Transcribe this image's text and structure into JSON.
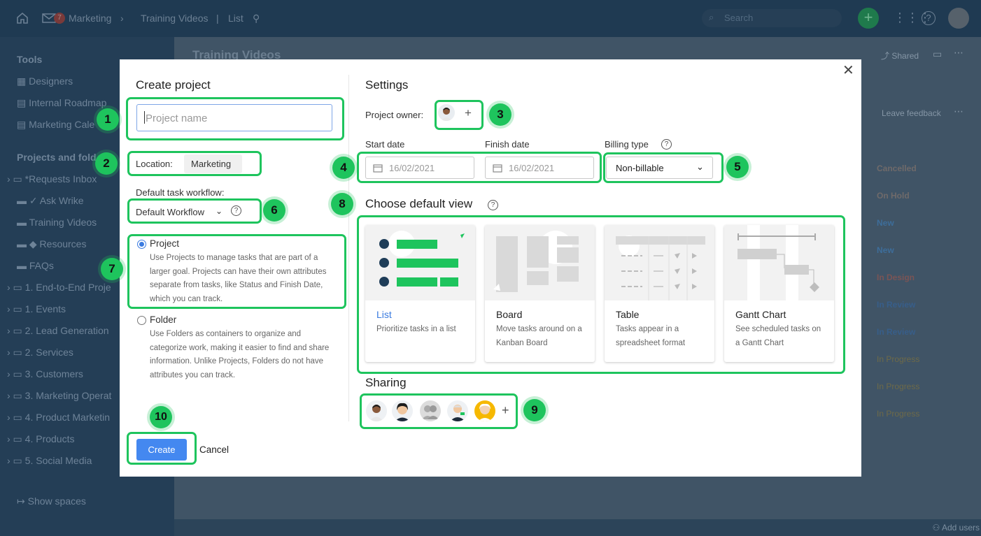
{
  "topbar": {
    "breadcrumb_space": "Marketing",
    "breadcrumb_folder": "Training Videos",
    "view": "List",
    "search_placeholder": "Search",
    "notification_count": "7"
  },
  "sidebar": {
    "tools_heading": "Tools",
    "tools": [
      "Designers",
      "Internal Roadmap",
      "Marketing Cale"
    ],
    "projects_heading": "Projects and fold",
    "items": [
      "*Requests Inbox",
      "Ask Wrike",
      "Training Videos",
      "Resources",
      "FAQs",
      "1. End-to-End Proje",
      "1. Events",
      "2. Lead Generation",
      "2. Services",
      "3. Customers",
      "3. Marketing Operat",
      "4. Product Marketin",
      "4. Products",
      "5. Social Media"
    ],
    "show_spaces": "Show spaces"
  },
  "background_main": {
    "page_title": "Training Videos",
    "shared": "Shared",
    "leave_feedback": "Leave feedback",
    "statuses": [
      "Cancelled",
      "On Hold",
      "New",
      "New",
      "In Design",
      "In Review",
      "In Review",
      "In Progress",
      "In Progress",
      "In Progress"
    ],
    "add_users": "Add users"
  },
  "modal": {
    "title": "Create project",
    "name_placeholder": "Project name",
    "location_label": "Location:",
    "location_value": "Marketing",
    "workflow_label": "Default task workflow:",
    "workflow_value": "Default Workflow",
    "project_option": {
      "label": "Project",
      "description": "Use Projects to manage tasks that are part of a larger goal. Projects can have their own attributes separate from tasks, like Status and Finish Date, which you can track."
    },
    "folder_option": {
      "label": "Folder",
      "description": "Use Folders as containers to organize and categorize work, making it easier to find and share information. Unlike Projects, Folders do not have attributes you can track."
    },
    "create_label": "Create",
    "cancel_label": "Cancel",
    "settings_title": "Settings",
    "owner_label": "Project owner:",
    "start_date_label": "Start date",
    "start_date_value": "16/02/2021",
    "finish_date_label": "Finish date",
    "finish_date_value": "16/02/2021",
    "billing_label": "Billing type",
    "billing_value": "Non-billable",
    "default_view_title": "Choose default view",
    "views": [
      {
        "name": "List",
        "description": "Prioritize tasks in a list"
      },
      {
        "name": "Board",
        "description": "Move tasks around on a Kanban Board"
      },
      {
        "name": "Table",
        "description": "Tasks appear in a spreadsheet format"
      },
      {
        "name": "Gantt Chart",
        "description": "See scheduled tasks on a Gantt Chart"
      }
    ],
    "sharing_title": "Sharing"
  },
  "annotations": [
    "1",
    "2",
    "3",
    "4",
    "5",
    "6",
    "7",
    "8",
    "9",
    "10"
  ],
  "colors": {
    "highlight": "#1ec45d",
    "primary_button": "#4488f0",
    "link": "#3a7be0",
    "backdrop": "#21394f"
  }
}
